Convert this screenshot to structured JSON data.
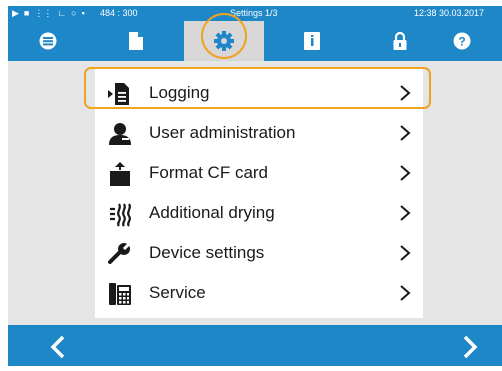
{
  "statusbar": {
    "coords": "484 : 300",
    "title": "Settings 1/3",
    "time": "12:38  30.03.2017",
    "icons": [
      "play-icon",
      "file-icon",
      "drying-icon",
      "chart-icon",
      "clock-icon",
      "lock-icon"
    ]
  },
  "tabs": [
    {
      "name": "menu-tab",
      "icon": "menu-icon",
      "active": false
    },
    {
      "name": "logs-tab",
      "icon": "document-icon",
      "active": false
    },
    {
      "name": "settings-tab",
      "icon": "gear-icon",
      "active": true
    },
    {
      "name": "info-tab",
      "icon": "info-book-icon",
      "active": false
    },
    {
      "name": "lock-tab",
      "icon": "lock-icon",
      "active": false
    },
    {
      "name": "help-tab",
      "icon": "help-icon",
      "active": false
    }
  ],
  "menu": {
    "items": [
      {
        "label": "Logging",
        "icon": "logging-icon"
      },
      {
        "label": "User administration",
        "icon": "user-icon"
      },
      {
        "label": "Format CF card",
        "icon": "cf-card-icon"
      },
      {
        "label": "Additional drying",
        "icon": "drying-icon"
      },
      {
        "label": "Device settings",
        "icon": "wrench-icon"
      },
      {
        "label": "Service",
        "icon": "phone-icon"
      }
    ],
    "highlighted_index": 0
  },
  "colors": {
    "primary": "#1e87c8",
    "highlight": "#f0a31e",
    "background": "#e5e5e5",
    "text": "#1a1a1a"
  },
  "nav": {
    "back": "chevron-left-icon",
    "forward": "chevron-right-icon"
  }
}
